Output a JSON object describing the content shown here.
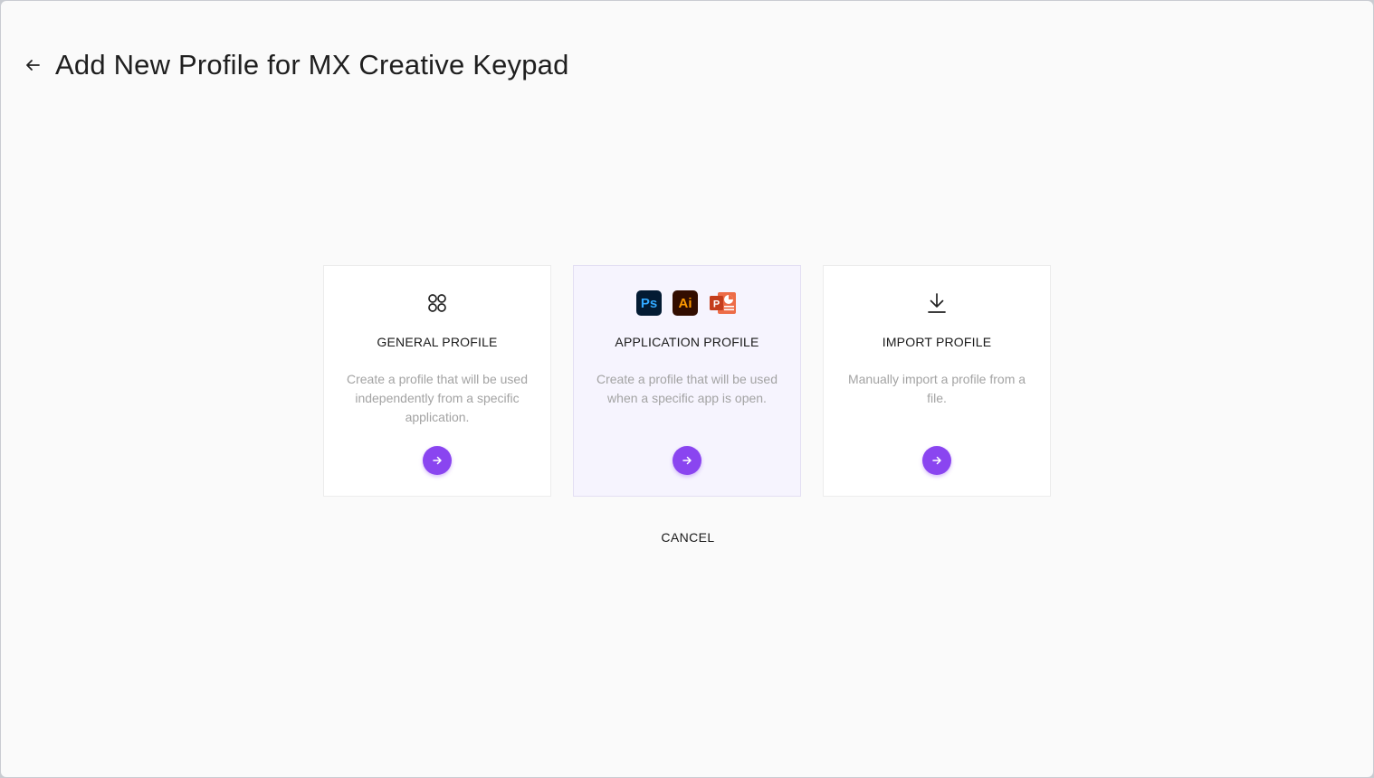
{
  "header": {
    "back_icon": "arrow-left-icon",
    "title": "Add New Profile for MX Creative Keypad"
  },
  "cards": [
    {
      "id": "general",
      "icon": "four-circles-icon",
      "title": "GENERAL PROFILE",
      "description": "Create a profile that will be used independently from a specific application.",
      "selected": false
    },
    {
      "id": "application",
      "icons": [
        "photoshop-icon",
        "illustrator-icon",
        "powerpoint-icon"
      ],
      "ps_label": "Ps",
      "ai_label": "Ai",
      "pp_label": "P",
      "title": "APPLICATION PROFILE",
      "description": "Create a profile that will be used when a specific app is open.",
      "selected": true
    },
    {
      "id": "import",
      "icon": "download-icon",
      "title": "IMPORT PROFILE",
      "description": "Manually import a profile from a file.",
      "selected": false
    }
  ],
  "cancel_label": "CANCEL",
  "colors": {
    "accent": "#8a45f0",
    "selected_card_bg": "#f6f4fe",
    "background": "#fafafa"
  }
}
